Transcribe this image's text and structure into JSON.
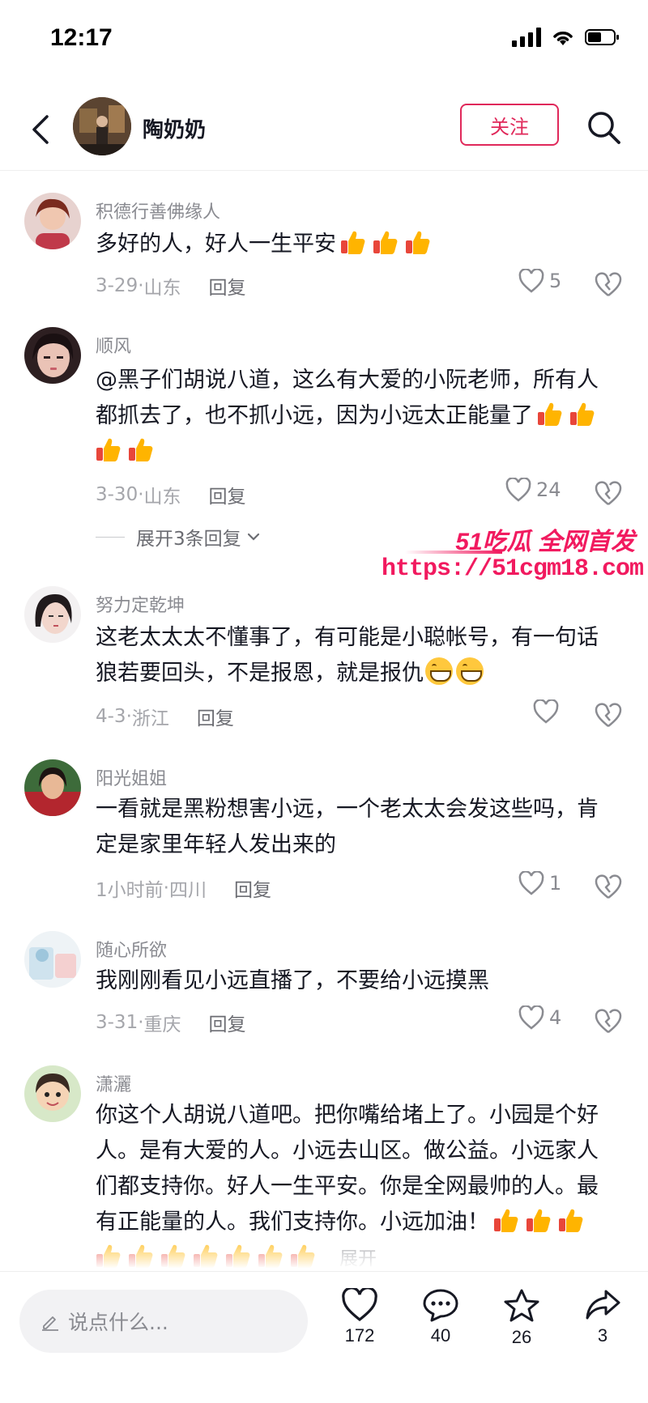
{
  "status": {
    "time": "12:17"
  },
  "header": {
    "name": "陶奶奶",
    "follow_label": "关注"
  },
  "comments": [
    {
      "user": "积德行善佛缘人",
      "text": "多好的人，好人一生平安",
      "thumbs": 3,
      "date": "3-29",
      "location": "山东",
      "reply": "回复",
      "likes": "5"
    },
    {
      "user": "顺风",
      "line1": "@黑子们胡说八道，这么有大爱的小阮老师，所有人",
      "line2": "都抓去了，也不抓小远，因为小远太正能量了",
      "thumbs": 4,
      "date": "3-30",
      "location": "山东",
      "reply": "回复",
      "likes": "24",
      "expand": "展开3条回复"
    },
    {
      "user": "努力定乾坤",
      "line1": "这老太太太不懂事了，有可能是小聪帐号，有一句话",
      "line2": "狼若要回头，不是报恩，就是报仇",
      "date": "4-3",
      "location": "浙江",
      "reply": "回复",
      "likes": ""
    },
    {
      "user": "阳光姐姐",
      "line1": "一看就是黑粉想害小远，一个老太太会发这些吗，肯",
      "line2": "定是家里年轻人发出来的",
      "date": "1小时前",
      "location": "四川",
      "reply": "回复",
      "likes": "1"
    },
    {
      "user": "随心所欲",
      "text": "我刚刚看见小远直播了，不要给小远摸黑",
      "date": "3-31",
      "location": "重庆",
      "reply": "回复",
      "likes": "4"
    },
    {
      "user": "潇灑",
      "line1": "你这个人胡说八道吧。把你嘴给堵上了。小园是个好",
      "line2": "人。是有大爱的人。小远去山区。做公益。小远家人",
      "line3": "们都支持你。好人一生平安。你是全网最帅的人。最",
      "line4": "有正能量的人。我们支持你。小远加油！",
      "expand": "展开"
    }
  ],
  "watermark": {
    "brand": "51吃瓜 全网首发",
    "url": "https://51cgm18.com"
  },
  "bottom": {
    "input_placeholder": "说点什么...",
    "like_count": "172",
    "comment_count": "40",
    "fav_count": "26",
    "share_count": "3"
  },
  "colors": {
    "accent": "#e0285a",
    "thumb": "#ffb400",
    "watermark": "#f11a5f"
  },
  "icons": [
    "back-arrow-icon",
    "search-icon",
    "heart-icon",
    "dislike-icon",
    "thumbs-up-icon",
    "grin-emoji-icon",
    "comment-icon",
    "star-icon",
    "share-icon",
    "pencil-icon"
  ]
}
